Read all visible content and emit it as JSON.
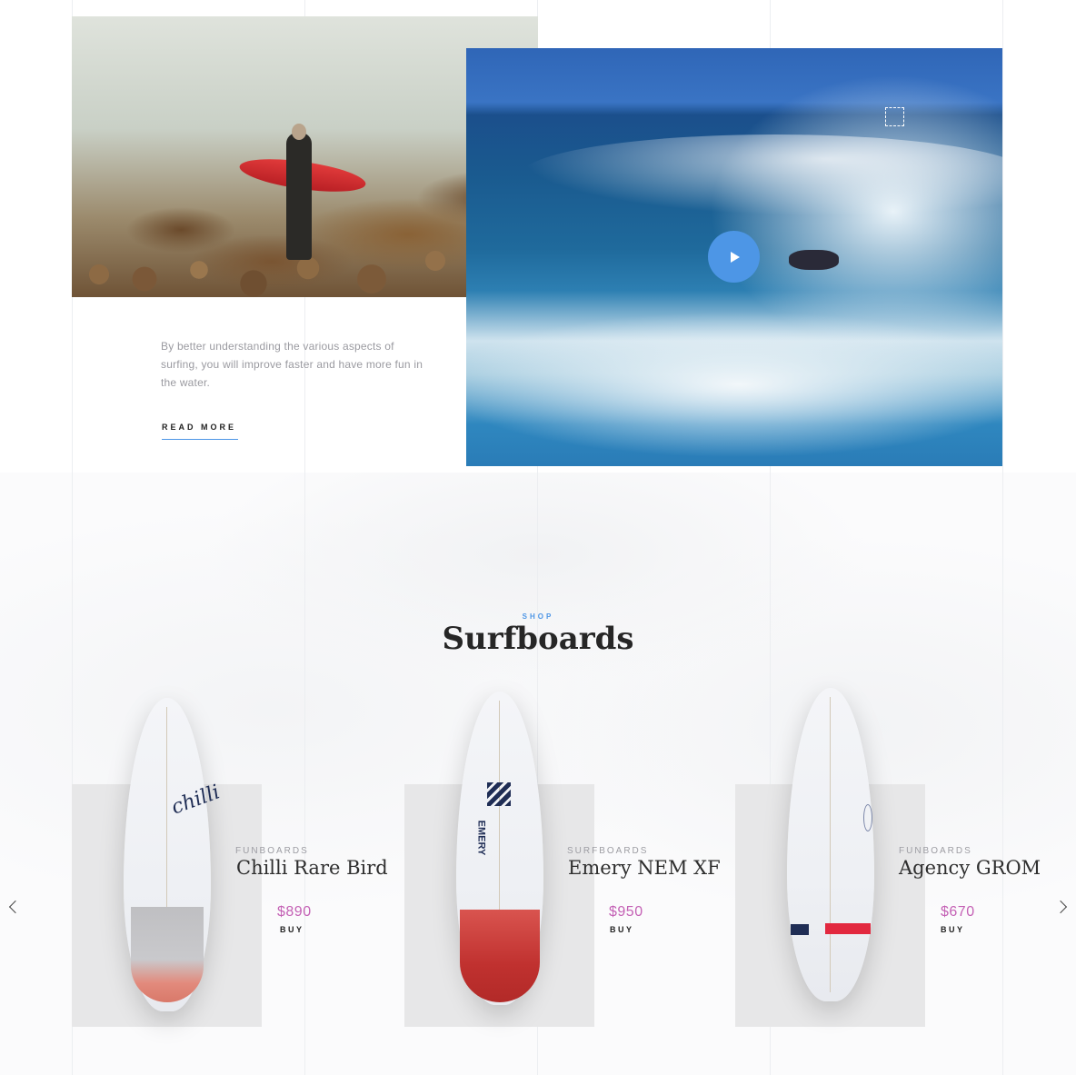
{
  "intro": {
    "text": "By better understanding the various aspects of surfing, you will improve faster and have more fun in the water.",
    "read_more_label": "READ MORE"
  },
  "video": {
    "play_icon": "play-icon"
  },
  "shop": {
    "eyebrow": "SHOP",
    "title": "Surfboards",
    "products": [
      {
        "category": "FUNBOARDS",
        "name": "Chilli Rare Bird",
        "price": "$890",
        "buy_label": "BUY"
      },
      {
        "category": "SURFBOARDS",
        "name": "Emery NEM XF",
        "price": "$950",
        "buy_label": "BUY"
      },
      {
        "category": "FUNBOARDS",
        "name": "Agency GROM",
        "price": "$670",
        "buy_label": "BUY"
      }
    ],
    "prev_icon": "chevron-left-icon",
    "next_icon": "chevron-right-icon"
  },
  "colors": {
    "accent_blue": "#4d96e6",
    "price_pink": "#c461b5",
    "card_gray": "#e7e7e8"
  }
}
